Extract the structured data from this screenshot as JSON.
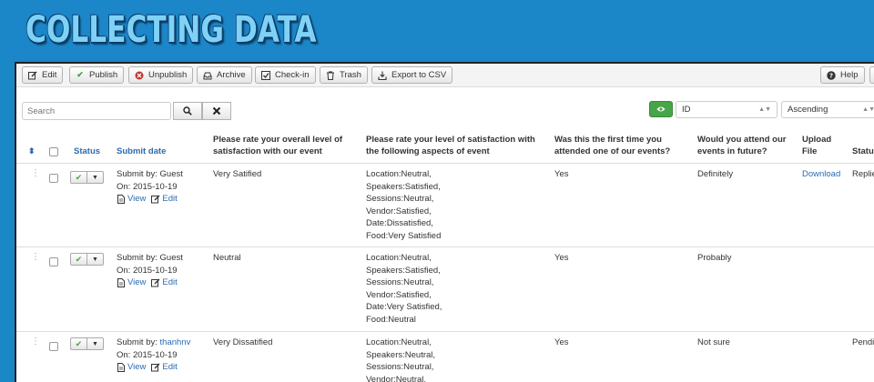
{
  "banner": {
    "title": "COLLECTING DATA"
  },
  "toolbar": {
    "edit": "Edit",
    "publish": "Publish",
    "unpublish": "Unpublish",
    "archive": "Archive",
    "checkin": "Check-in",
    "trash": "Trash",
    "export": "Export to CSV",
    "help": "Help"
  },
  "filters": {
    "search_placeholder": "Search",
    "sort_field": "ID",
    "sort_order": "Ascending"
  },
  "columns": {
    "status": "Status",
    "submit_date": "Submit date",
    "q1_line1": "Please rate your overall level of",
    "q1_line2": "satisfaction with our event",
    "q2_line1": "Please rate your level of satisfaction with",
    "q2_line2": "the following aspects of event",
    "q3_line1": "Was this the first time you",
    "q3_line2": "attended one of our events?",
    "q4_line1": "Would you attend our",
    "q4_line2": "events in future?",
    "upload_line1": "Upload",
    "upload_line2": "File",
    "status2": "Status"
  },
  "rows": [
    {
      "submit_by_label": "Submit by:",
      "submit_by": "Guest",
      "on": "On: 2015-10-19",
      "view": "View",
      "edit": "Edit",
      "overall": "Very Satified",
      "aspects": [
        "Location:Neutral,",
        "Speakers:Satisfied,",
        "Sessions:Neutral,",
        "Vendor:Satisfied,",
        "Date:Dissatisfied,",
        "Food:Very Satisfied"
      ],
      "first_time": "Yes",
      "future": "Definitely",
      "upload": "Download",
      "status2": "Replied"
    },
    {
      "submit_by_label": "Submit by:",
      "submit_by": "Guest",
      "on": "On: 2015-10-19",
      "view": "View",
      "edit": "Edit",
      "overall": "Neutral",
      "aspects": [
        "Location:Neutral,",
        "Speakers:Satisfied,",
        "Sessions:Neutral,",
        "Vendor:Satisfied,",
        "Date:Very Satisfied,",
        "Food:Neutral"
      ],
      "first_time": "Yes",
      "future": "Probably",
      "upload": "",
      "status2": ""
    },
    {
      "submit_by_label": "Submit by:",
      "submit_by": "thanhnv",
      "on": "On: 2015-10-19",
      "view": "View",
      "edit": "Edit",
      "overall": "Very Dissatified",
      "aspects": [
        "Location:Neutral,",
        "Speakers:Neutral,",
        "Sessions:Neutral,",
        "Vendor:Neutral,"
      ],
      "first_time": "Yes",
      "future": "Not sure",
      "upload": "",
      "status2": "Pending"
    }
  ]
}
